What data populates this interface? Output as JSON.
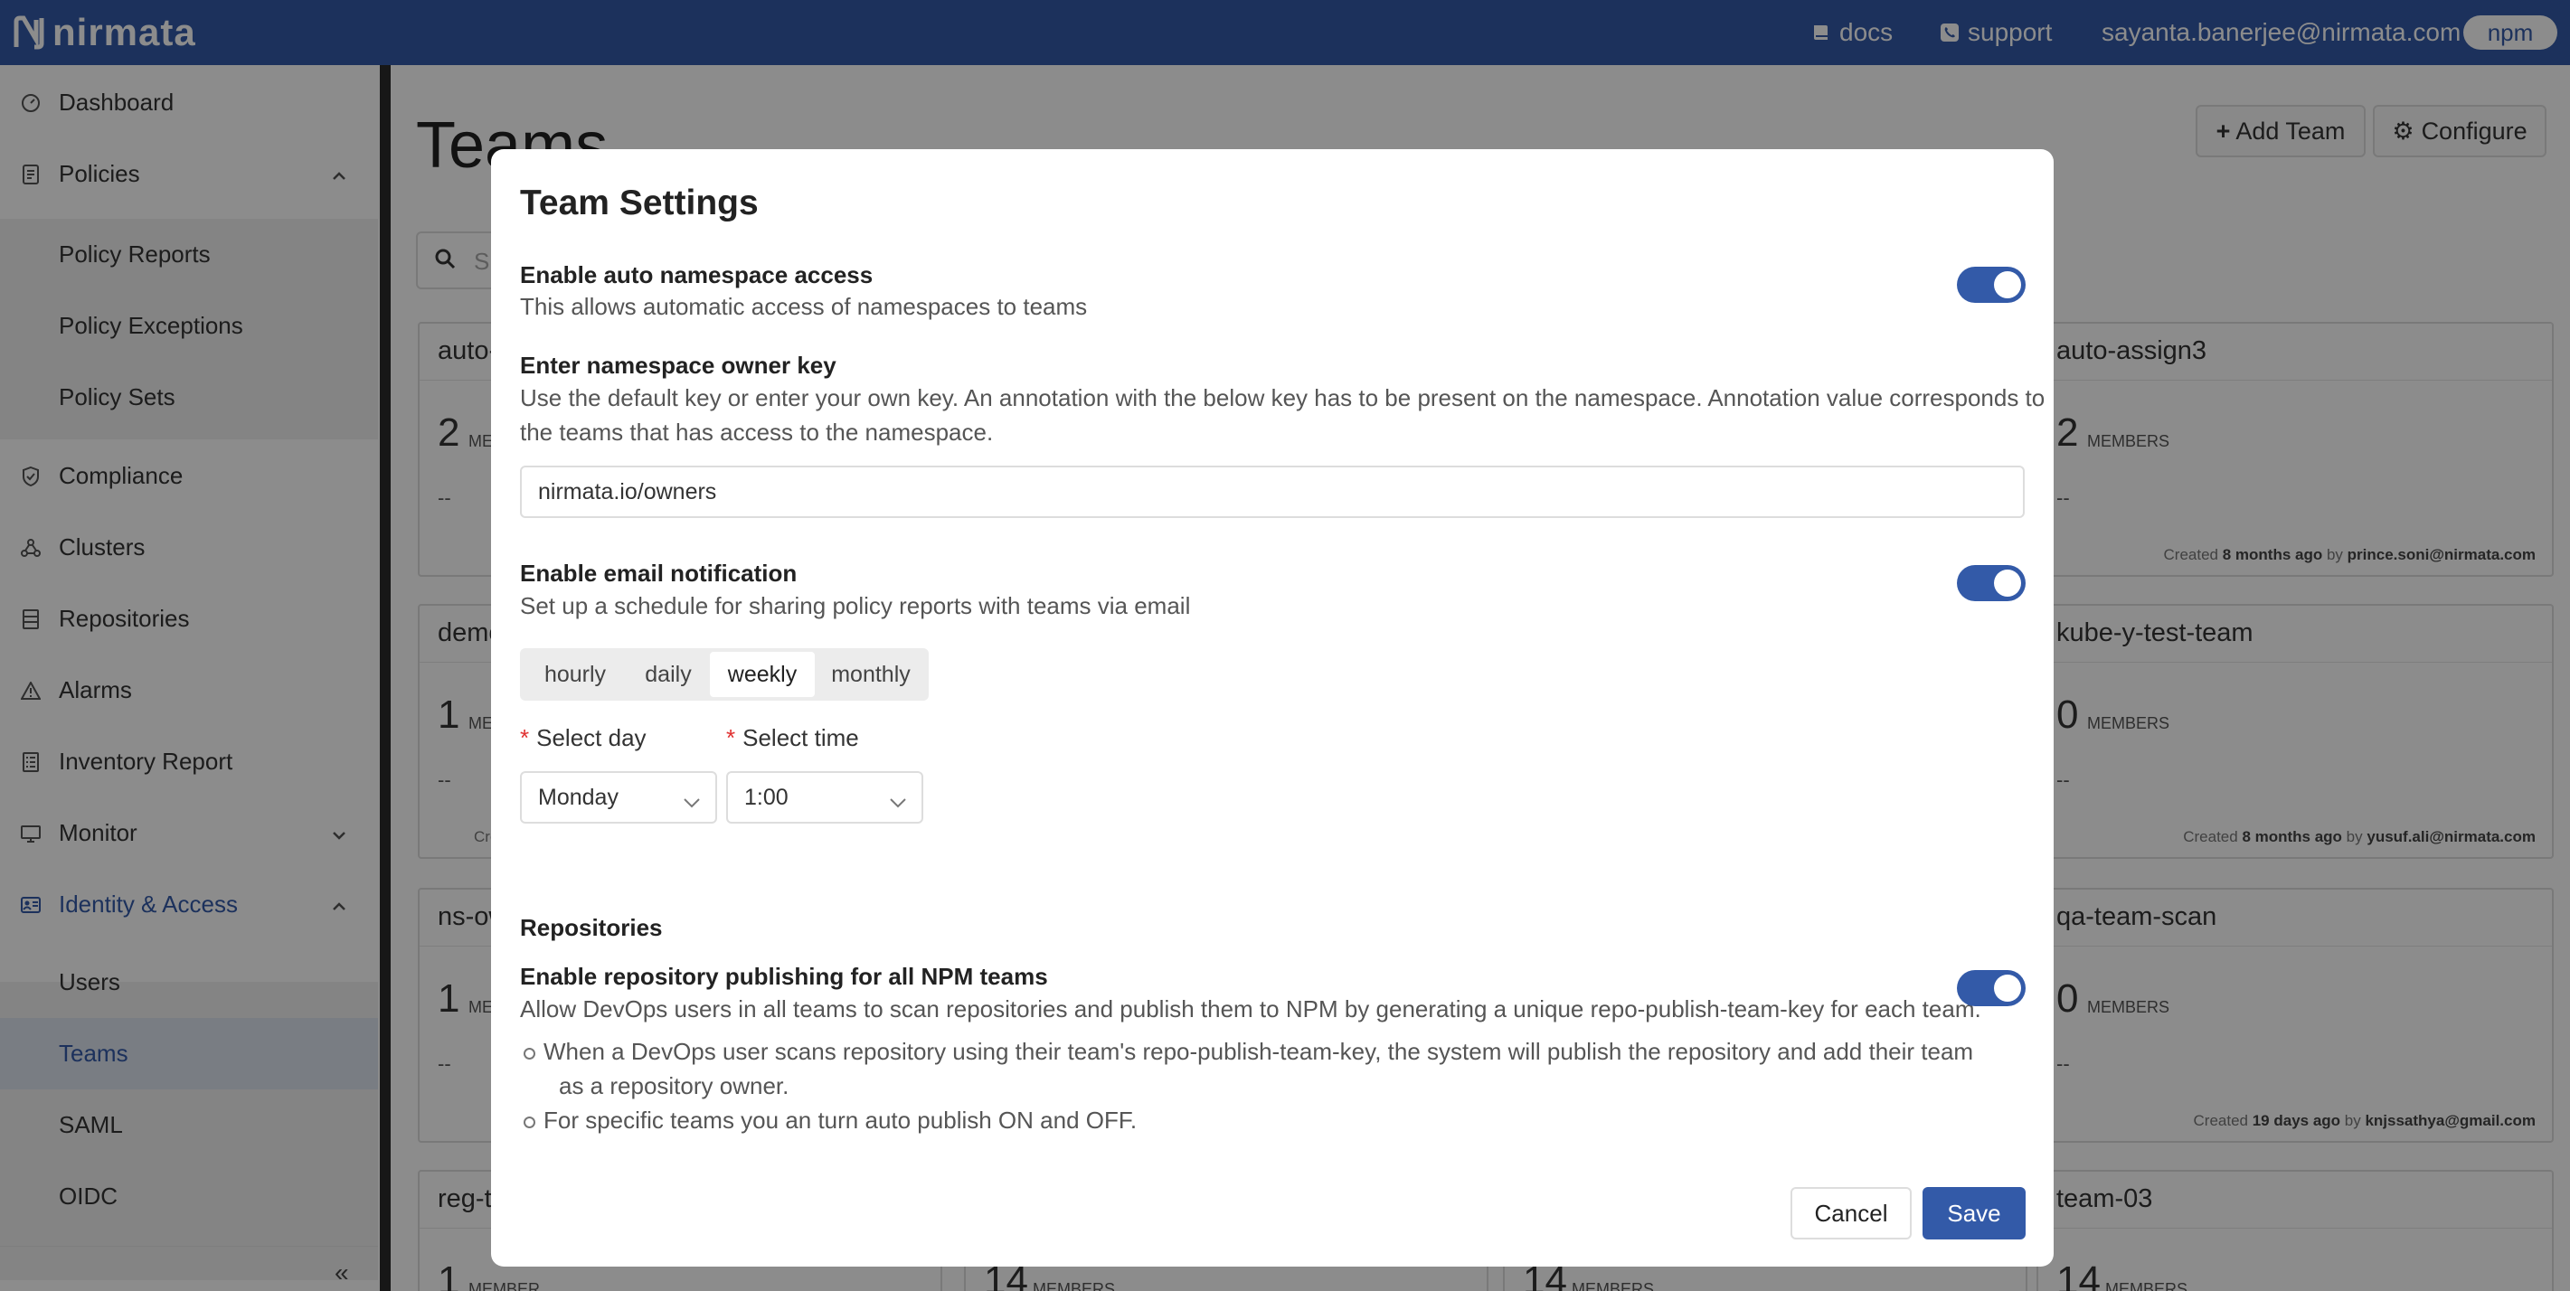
{
  "topbar": {
    "logo": "nirmata",
    "docs": "docs",
    "support": "support",
    "user": "sayanta.banerjee@nirmata.com",
    "tenant": "npm"
  },
  "sidebar": {
    "items": [
      {
        "label": "Dashboard",
        "icon": "dashboard-icon"
      },
      {
        "label": "Policies",
        "icon": "policies-icon"
      },
      {
        "label": "Policy Reports"
      },
      {
        "label": "Policy Exceptions"
      },
      {
        "label": "Policy Sets"
      },
      {
        "label": "Compliance",
        "icon": "shield-check-icon"
      },
      {
        "label": "Clusters",
        "icon": "clusters-icon"
      },
      {
        "label": "Repositories",
        "icon": "repositories-icon"
      },
      {
        "label": "Alarms",
        "icon": "warning-icon"
      },
      {
        "label": "Inventory Report",
        "icon": "inventory-icon"
      },
      {
        "label": "Monitor",
        "icon": "monitor-icon"
      },
      {
        "label": "Identity & Access",
        "icon": "id-card-icon"
      },
      {
        "label": "Users"
      },
      {
        "label": "Teams"
      },
      {
        "label": "SAML"
      },
      {
        "label": "OIDC"
      }
    ],
    "collapse_glyph": "«",
    "active": "Teams"
  },
  "main": {
    "title": "Teams",
    "add_team": "Add Team",
    "configure": "Configure",
    "search_placeholder": "S",
    "cards": [
      {
        "name": "auto-",
        "count": "2",
        "members": "MEM",
        "dash": "--"
      },
      {
        "name": "auto-assign3",
        "count": "2",
        "members": "MEMBERS",
        "dash": "--",
        "created_pre": "Created ",
        "created_when": "8 months ago",
        "created_mid": " by ",
        "created_by": "prince.soni@nirmata.com"
      },
      {
        "name": "demo",
        "count": "1",
        "members": "ME",
        "dash": "--",
        "partial": "Cre"
      },
      {
        "name": "kube-y-test-team",
        "count": "0",
        "members": "MEMBERS",
        "dash": "--",
        "created_pre": "Created ",
        "created_when": "8 months ago",
        "created_mid": " by ",
        "created_by": "yusuf.ali@nirmata.com"
      },
      {
        "name": "ns-ow",
        "count": "1",
        "members": "ME",
        "dash": "--"
      },
      {
        "name": "qa-team-scan",
        "count": "0",
        "members": "MEMBERS",
        "dash": "--",
        "created_pre": "Created ",
        "created_when": "19 days ago",
        "created_mid": " by ",
        "created_by": "knjssathya@gmail.com"
      },
      {
        "name": "reg-t",
        "count": "1",
        "members": "MEMBER"
      },
      {
        "name": "",
        "count": "14",
        "members": "MEMBERS"
      },
      {
        "name": "",
        "count": "14",
        "members": "MEMBERS"
      },
      {
        "name": "team-03",
        "count": "14",
        "members": "MEMBERS"
      }
    ]
  },
  "modal": {
    "title": "Team Settings",
    "auto_ns_heading": "Enable auto namespace access",
    "auto_ns_desc": "This allows automatic access of namespaces to teams",
    "auto_ns_enabled": true,
    "owner_key_heading": "Enter namespace owner key",
    "owner_key_desc_1": "Use the default key or enter your own key. An annotation with the below key has to be present on the namespace. Annotation value corresponds to",
    "owner_key_desc_2": "the teams that has access to the namespace.",
    "owner_key_value": "nirmata.io/owners",
    "email_heading": "Enable email notification",
    "email_desc": "Set up a schedule for sharing policy reports with teams via email",
    "email_enabled": true,
    "schedule_options": [
      "hourly",
      "daily",
      "weekly",
      "monthly"
    ],
    "schedule_selected": "weekly",
    "select_day_label": "Select day",
    "select_day_value": "Monday",
    "select_time_label": "Select time",
    "select_time_value": "1:00",
    "required_mark": "*",
    "repos_heading": "Repositories",
    "repo_pub_heading": "Enable repository publishing for all NPM teams",
    "repo_pub_desc": "Allow DevOps users in all teams to scan repositories and publish them to NPM by generating a unique repo-publish-team-key for each team.",
    "repo_pub_enabled": true,
    "bullet_1a": "When a DevOps user scans repository using their team's repo-publish-team-key, the system will publish the repository and add their team",
    "bullet_1b": "as a repository owner.",
    "bullet_2": "For specific teams you an turn auto publish ON and OFF.",
    "cancel": "Cancel",
    "save": "Save"
  },
  "colors": {
    "brand": "#335aa8",
    "accent_text": "#335aa8",
    "toggle_on": "#335aa8"
  }
}
